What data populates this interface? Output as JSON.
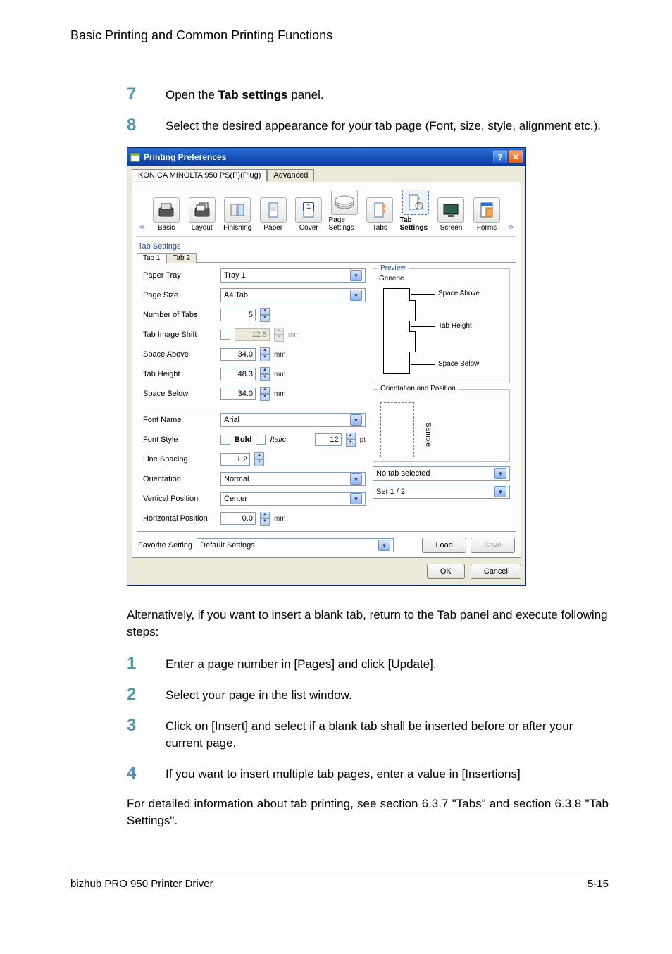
{
  "doc": {
    "page_header": "Basic Printing and Common Printing Functions",
    "steps_set1": {
      "n7": "7",
      "t7_a": "Open the ",
      "t7_b": "Tab settings",
      "t7_c": " panel.",
      "n8": "8",
      "t8": "Select the desired appearance for your tab page (Font, size, style, alignment etc.)."
    },
    "intertext": "Alternatively, if you want to insert a blank tab, return to the Tab panel and execute following steps:",
    "steps_set2": {
      "n1": "1",
      "t1": "Enter a page number in [Pages] and click [Update].",
      "n2": "2",
      "t2": "Select your page in the list window.",
      "n3": "3",
      "t3": "Click on [Insert] and select if a blank tab shall be inserted before or after your current page.",
      "n4": "4",
      "t4": "If you want to insert multiple tab pages, enter a value in [Insertions]"
    },
    "xref": "For detailed information about tab printing, see section 6.3.7 \"Tabs\" and section 6.3.8 \"Tab Settings\".",
    "footer_left": "bizhub PRO 950 Printer Driver",
    "footer_right": "5-15"
  },
  "dialog": {
    "title": "Printing Preferences",
    "driver_tabs": {
      "active": "KONICA MINOLTA 950 PS(P)(Plug)",
      "inactive": "Advanced"
    },
    "nav": {
      "left_arrow": "«",
      "right_arrow": "»",
      "items": [
        "Basic",
        "Layout",
        "Finishing",
        "Paper",
        "Cover",
        "Page Settings",
        "Tabs",
        "Tab Settings",
        "Screen",
        "Forms"
      ],
      "selected": "Tab Settings",
      "badge": "1"
    },
    "tabsettings": {
      "heading": "Tab Settings",
      "subtabs": {
        "active": "Tab 1",
        "inactive": "Tab 2"
      },
      "fields": {
        "paper_tray": {
          "label": "Paper Tray",
          "value": "Tray 1"
        },
        "page_size": {
          "label": "Page Size",
          "value": "A4 Tab"
        },
        "num_tabs": {
          "label": "Number of Tabs",
          "value": "5"
        },
        "image_shift": {
          "label": "Tab Image Shift",
          "value": "12.5",
          "unit": "mm",
          "enabled": false
        },
        "space_above": {
          "label": "Space Above",
          "value": "34.0",
          "unit": "mm"
        },
        "tab_height": {
          "label": "Tab Height",
          "value": "48.3",
          "unit": "mm"
        },
        "space_below": {
          "label": "Space Below",
          "value": "34.0",
          "unit": "mm"
        },
        "font_name": {
          "label": "Font Name",
          "value": "Arial"
        },
        "font_style": {
          "label": "Font Style",
          "bold": "Bold",
          "italic": "Italic",
          "size": "12",
          "unit": "pt"
        },
        "line_spacing": {
          "label": "Line Spacing",
          "value": "1.2"
        },
        "orientation": {
          "label": "Orientation",
          "value": "Normal"
        },
        "vpos": {
          "label": "Vertical Position",
          "value": "Center"
        },
        "hpos": {
          "label": "Horizontal Position",
          "value": "0.0",
          "unit": "mm"
        }
      },
      "preview": {
        "group": "Preview",
        "generic": "Generic",
        "space_above": "Space Above",
        "tab_height": "Tab Height",
        "space_below": "Space Below",
        "orient_group": "Orientation and Position",
        "sample": "Sample",
        "notab": "No tab selected",
        "set": "Set 1 / 2"
      }
    },
    "bottom": {
      "fav_label": "Favorite Setting",
      "fav_value": "Default Settings",
      "load": "Load",
      "save": "Save",
      "ok": "OK",
      "cancel": "Cancel"
    }
  }
}
